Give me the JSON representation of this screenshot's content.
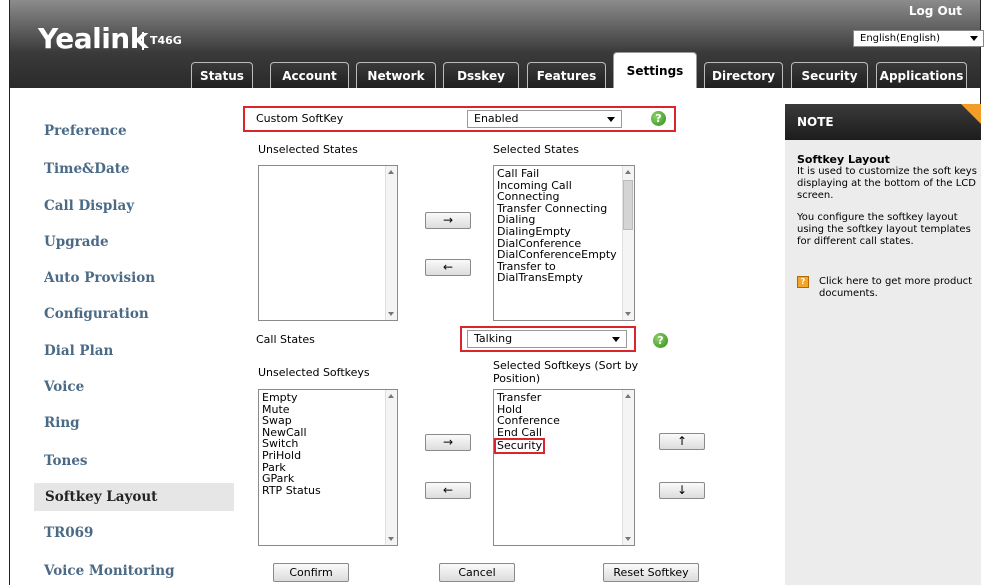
{
  "header": {
    "logo": "Yealink",
    "model": "T46G",
    "logout": "Log Out",
    "language": "English(English)"
  },
  "tabs": [
    "Status",
    "Account",
    "Network",
    "Dsskey",
    "Features",
    "Settings",
    "Directory",
    "Security",
    "Applications"
  ],
  "active_tab": "Settings",
  "sidebar": {
    "items": [
      "Preference",
      "Time&Date",
      "Call Display",
      "Upgrade",
      "Auto Provision",
      "Configuration",
      "Dial Plan",
      "Voice",
      "Ring",
      "Tones",
      "Softkey Layout",
      "TR069",
      "Voice Monitoring"
    ],
    "active": "Softkey Layout"
  },
  "form": {
    "custom_softkey_label": "Custom SoftKey",
    "custom_softkey_value": "Enabled",
    "unselected_states_label": "Unselected States",
    "selected_states_label": "Selected States",
    "selected_states": [
      "Call Fail",
      "Incoming Call",
      "Connecting",
      "Transfer Connecting",
      "Dialing",
      "DialingEmpty",
      "DialConference",
      "DialConferenceEmpty",
      "Transfer to",
      "DialTransEmpty"
    ],
    "call_states_label": "Call States",
    "call_states_value": "Talking",
    "unselected_softkeys_label": "Unselected Softkeys",
    "selected_softkeys_label": "Selected Softkeys (Sort by Position)",
    "unselected_softkeys": [
      "Empty",
      "Mute",
      "Swap",
      "NewCall",
      "Switch",
      "PriHold",
      "Park",
      "GPark",
      "RTP Status"
    ],
    "selected_softkeys": [
      "Transfer",
      "Hold",
      "Conference",
      "End Call",
      "Security"
    ],
    "move_right": "→",
    "move_left": "←",
    "move_up": "↑",
    "move_down": "↓",
    "confirm": "Confirm",
    "cancel": "Cancel",
    "reset": "Reset Softkey",
    "help": "?"
  },
  "note": {
    "header": "NOTE",
    "title": "Softkey Layout",
    "text1": "It is used to customize the soft keys displaying at the bottom of the LCD screen.",
    "text2": "You configure the softkey layout using the softkey layout templates for different call states.",
    "link": "Click here to get more product documents."
  }
}
